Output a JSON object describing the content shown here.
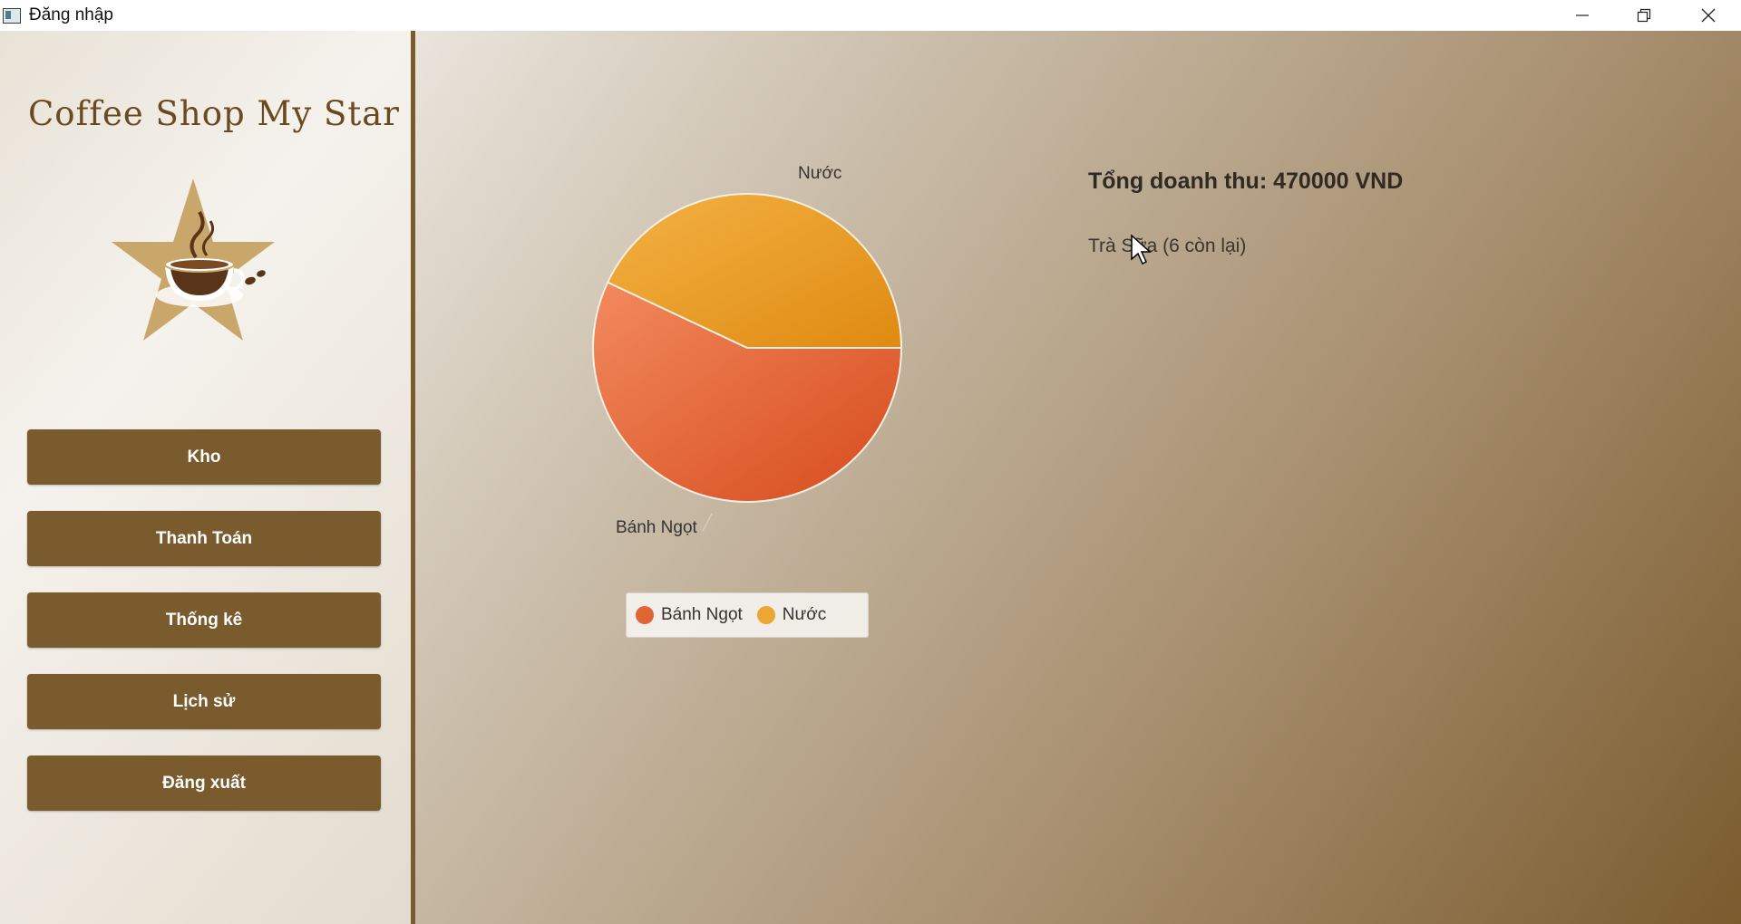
{
  "window": {
    "title": "Đăng nhập"
  },
  "sidebar": {
    "shop_title": "Coffee Shop My Star",
    "logo_icon": "coffee-star-logo-icon",
    "buttons": [
      {
        "label": "Kho"
      },
      {
        "label": "Thanh Toán"
      },
      {
        "label": "Thống kê"
      },
      {
        "label": "Lịch sử"
      },
      {
        "label": "Đăng xuất"
      }
    ]
  },
  "stats": {
    "revenue_text": "Tổng doanh thu: 470000 VND",
    "stock_item": "Trà Sữa (6 còn lại)"
  },
  "colors": {
    "accent": "#7a5b2e",
    "banh_ngot": "#e06535",
    "nuoc": "#eea531"
  },
  "chart_data": {
    "type": "pie",
    "title": "",
    "slices": [
      {
        "label": "Bánh Ngọt",
        "value": 57,
        "color": "#e06535"
      },
      {
        "label": "Nước",
        "value": 43,
        "color": "#eea531"
      }
    ],
    "legend": [
      "Bánh Ngọt",
      "Nước"
    ],
    "legend_position": "bottom"
  }
}
